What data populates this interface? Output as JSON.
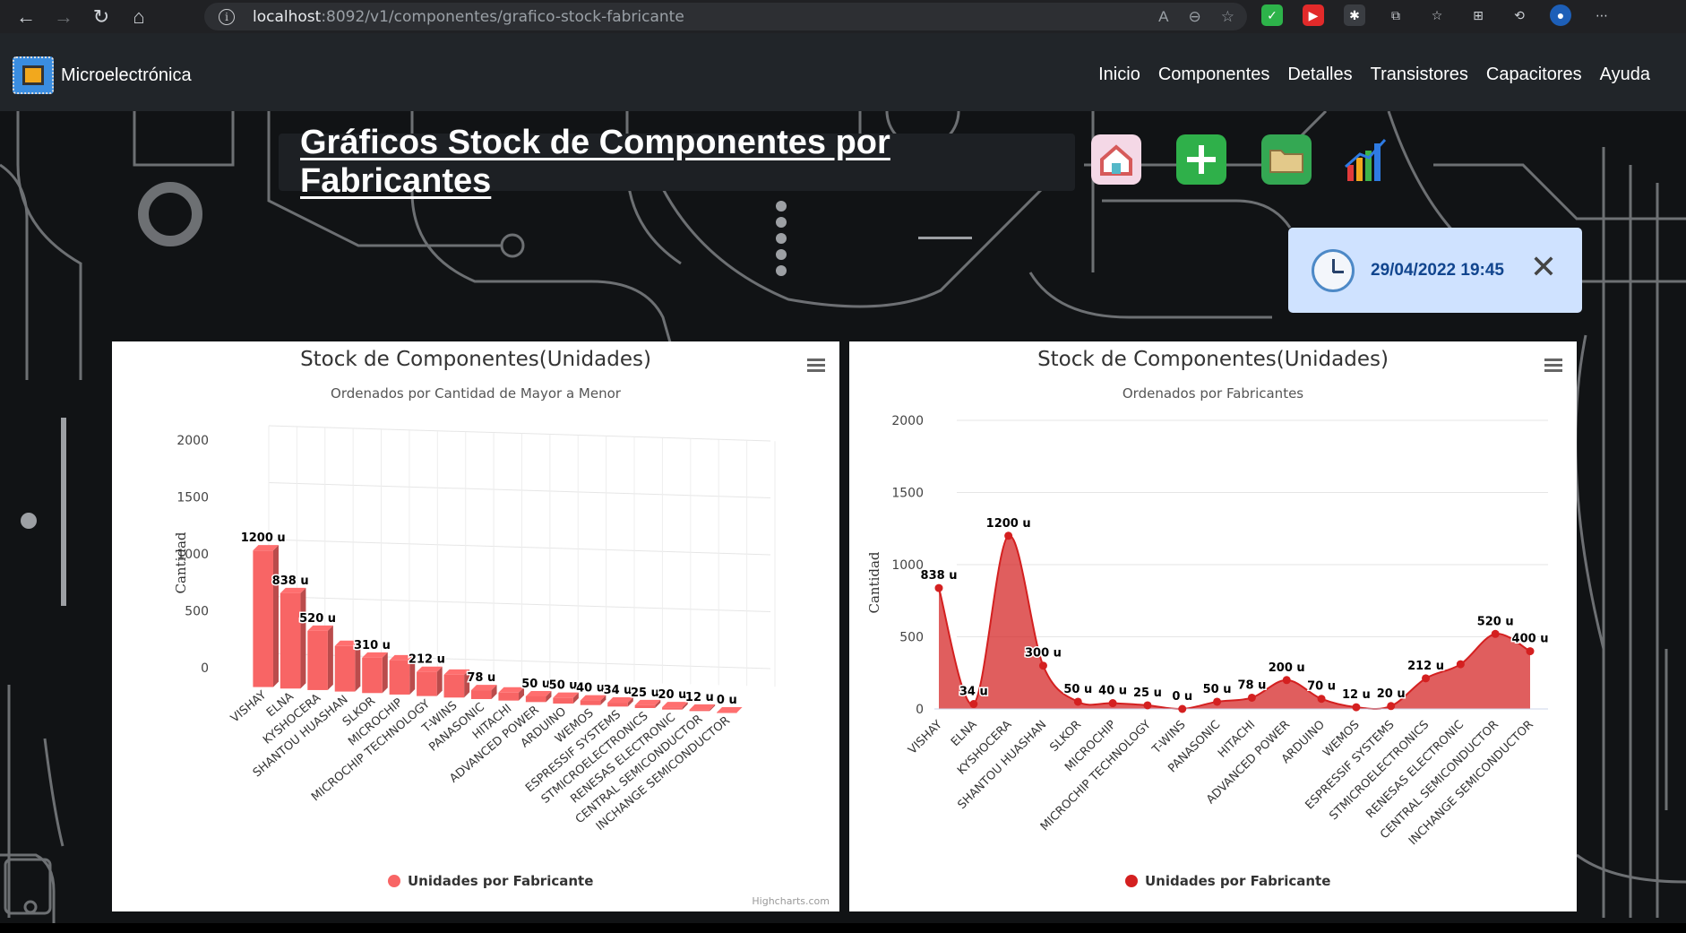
{
  "browser": {
    "url_host": "localhost",
    "url_rest": ":8092/v1/componentes/grafico-stock-fabricante"
  },
  "navbar": {
    "brand": "Microelectrónica",
    "menu": [
      "Inicio",
      "Componentes",
      "Detalles",
      "Transistores",
      "Capacitores",
      "Ayuda"
    ]
  },
  "page_title": "Gráficos Stock de Componentes por Fabricantes",
  "toolbar_icons": [
    "home-icon",
    "add-icon",
    "folder-icon",
    "chart-icon"
  ],
  "toast": {
    "datetime": "29/04/2022 19:45",
    "close": "✕"
  },
  "chart_data": [
    {
      "type": "bar",
      "render": "3d-column",
      "title": "Stock de Componentes(Unidades)",
      "subtitle": "Ordenados por Cantidad de Mayor a Menor",
      "ylabel": "Cantidad",
      "ylim": [
        0,
        2000
      ],
      "yticks": [
        0,
        500,
        1000,
        1500,
        2000
      ],
      "categories": [
        "VISHAY",
        "ELNA",
        "KYSHOCERA",
        "SHANTOU HUASHAN",
        "SLKOR",
        "MICROCHIP",
        "MICROCHIP TECHNOLOGY",
        "T-WINS",
        "PANASONIC",
        "HITACHI",
        "ADVANCED POWER",
        "ARDUINO",
        "WEMOS",
        "ESPRESSIF SYSTEMS",
        "STMICROELECTRONICS",
        "RENESAS ELECTRONIC",
        "CENTRAL SEMICONDUCTOR",
        "INCHANGE SEMICONDUCTOR"
      ],
      "series": [
        {
          "name": "Unidades por Fabricante",
          "values": [
            1200,
            838,
            520,
            400,
            310,
            300,
            212,
            200,
            78,
            70,
            50,
            50,
            40,
            34,
            25,
            20,
            12,
            0
          ]
        }
      ],
      "data_labels": [
        "1200 u",
        "838 u",
        "520 u",
        "",
        "310 u",
        "",
        "212 u",
        "",
        "78 u",
        "",
        "50 u",
        "50 u",
        "40 u",
        "34 u",
        "25 u",
        "20 u",
        "12 u",
        "0 u"
      ],
      "color": "#f86565",
      "legend": "bottom-center",
      "credits": "Highcharts.com",
      "grid": true
    },
    {
      "type": "area",
      "title": "Stock de Componentes(Unidades)",
      "subtitle": "Ordenados por Fabricantes",
      "ylabel": "Cantidad",
      "ylim": [
        0,
        2000
      ],
      "yticks": [
        0,
        500,
        1000,
        1500,
        2000
      ],
      "categories": [
        "VISHAY",
        "ELNA",
        "KYSHOCERA",
        "SHANTOU HUASHAN",
        "SLKOR",
        "MICROCHIP",
        "MICROCHIP TECHNOLOGY",
        "T-WINS",
        "PANASONIC",
        "HITACHI",
        "ADVANCED POWER",
        "ARDUINO",
        "WEMOS",
        "ESPRESSIF SYSTEMS",
        "STMICROELECTRONICS",
        "RENESAS ELECTRONIC",
        "CENTRAL SEMICONDUCTOR",
        "INCHANGE SEMICONDUCTOR"
      ],
      "series": [
        {
          "name": "Unidades por Fabricante",
          "values": [
            838,
            34,
            1200,
            300,
            50,
            40,
            25,
            0,
            50,
            78,
            200,
            70,
            12,
            20,
            212,
            310,
            520,
            400
          ]
        }
      ],
      "data_labels": [
        "838 u",
        "34 u",
        "1200 u",
        "300 u",
        "50 u",
        "40 u",
        "25 u",
        "0 u",
        "50 u",
        "78 u",
        "200 u",
        "70 u",
        "12 u",
        "20 u",
        "212 u",
        "",
        "520 u",
        "400 u"
      ],
      "color": "#d42020",
      "legend": "bottom-center",
      "grid": true
    }
  ]
}
